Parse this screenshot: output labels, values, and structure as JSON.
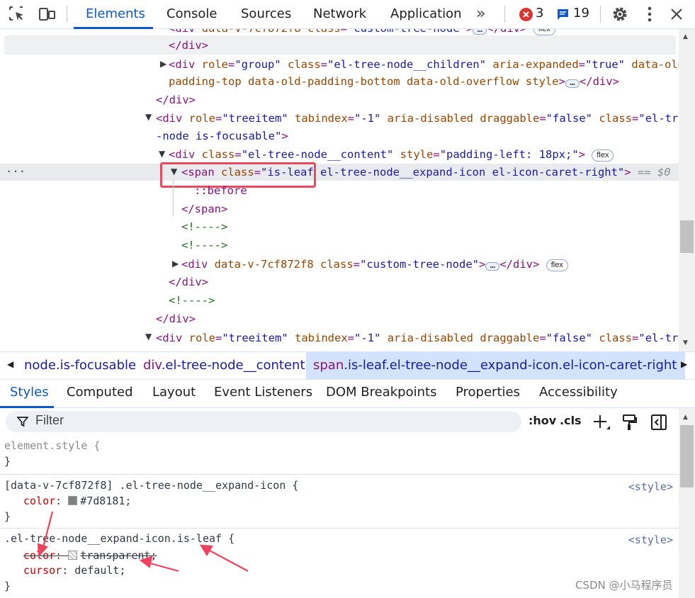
{
  "toolbar": {
    "tabs": [
      "Elements",
      "Console",
      "Sources",
      "Network",
      "Application"
    ],
    "more_tabs_glyph": "»",
    "error_count": "3",
    "message_count": "19",
    "icons": [
      "inspect-element-icon",
      "device-toolbar-icon",
      "error-icon",
      "message-icon",
      "settings-gear-icon",
      "more-vertical-icon",
      "close-icon"
    ],
    "colors": {
      "active": "#0b57d0",
      "error": "#dc362e",
      "message": "#0b57d0"
    }
  },
  "dom": {
    "line0": {
      "tag": "<div",
      "attr": "data-v-7cf872f8",
      "class_attr": "class",
      "class_val": "\"custom-tree-node\"",
      "end": "</div>",
      "badge": "flex"
    },
    "line1": {
      "text": "</div>"
    },
    "line2a": {
      "open": "<div",
      "attr1": "role",
      "val1": "\"group\"",
      "attr2": "class",
      "val2": "\"el-tree-node__children\"",
      "attr3": "aria-expanded",
      "val3": "\"true\"",
      "attr4": "data-old-"
    },
    "line2b": {
      "attr": "padding-top data-old-padding-bottom data-old-overflow style",
      "end": "</div>"
    },
    "line3": {
      "text": "</div>"
    },
    "line4a": {
      "open": "<div",
      "attr1": "role",
      "val1": "\"treeitem\"",
      "attr2": "tabindex",
      "val2": "\"-1\"",
      "attr3": "aria-disabled draggable",
      "val3": "\"false\"",
      "attr4": "class",
      "val4": "\"el-tree"
    },
    "line4b": {
      "val": "-node is-focusable\"",
      "close": ">"
    },
    "line5": {
      "open": "<div",
      "attr1": "class",
      "val1": "\"el-tree-node__content\"",
      "attr2": "style",
      "val2": "\"padding-left: 18px;\"",
      "badge": "flex"
    },
    "line6": {
      "open": "<span",
      "attr": "class",
      "val_a": "\"is-leaf",
      "val_b": " el-tree-node__expand-icon el-icon-caret-right\"",
      "close": ">",
      "marker": "== $0",
      "dots": "···"
    },
    "line7": {
      "text": "::before"
    },
    "line8": {
      "text": "</span>"
    },
    "line9": {
      "text": "<!---->"
    },
    "line10": {
      "text": "<!---->"
    },
    "line11": {
      "open": "<div",
      "attr1": "data-v-7cf872f8",
      "attr2": "class",
      "val2": "\"custom-tree-node\"",
      "end": "</div>",
      "badge": "flex"
    },
    "line12": {
      "text": "</div>"
    },
    "line13": {
      "text": "<!---->"
    },
    "line14": {
      "text": "</div>"
    },
    "line15": {
      "open": "<div",
      "attr1": "role",
      "val1": "\"treeitem\"",
      "attr2": "tabindex",
      "val2": "\"-1\"",
      "attr3": "aria-disabled draggable",
      "val3": "\"false\"",
      "attr4": "class",
      "val4": "\"el-tree"
    }
  },
  "breadcrumbs": [
    {
      "tag": "",
      "cls": "node.is-focusable"
    },
    {
      "tag": "div",
      "cls": ".el-tree-node__content"
    },
    {
      "tag": "span",
      "cls": ".is-leaf.el-tree-node__expand-icon.el-icon-caret-right"
    }
  ],
  "style_tabs": [
    "Styles",
    "Computed",
    "Layout",
    "Event Listeners",
    "DOM Breakpoints",
    "Properties",
    "Accessibility"
  ],
  "filter": {
    "placeholder": "Filter",
    "hov": ":hov",
    "cls": ".cls"
  },
  "rules": {
    "r1": {
      "selector": "element.style {",
      "close": "}"
    },
    "r2": {
      "selector": "[data-v-7cf872f8] .el-tree-node__expand-icon {",
      "source": "<style>",
      "prop": "color",
      "value": "#7d8181;",
      "swatch": "#7d8181",
      "close": "}"
    },
    "r3": {
      "selector": ".el-tree-node__expand-icon.is-leaf {",
      "source": "<style>",
      "prop1": "color",
      "value1": "transparent;",
      "prop2": "cursor",
      "value2": "default;",
      "close": "}"
    }
  },
  "watermark": "CSDN @小马程序员"
}
